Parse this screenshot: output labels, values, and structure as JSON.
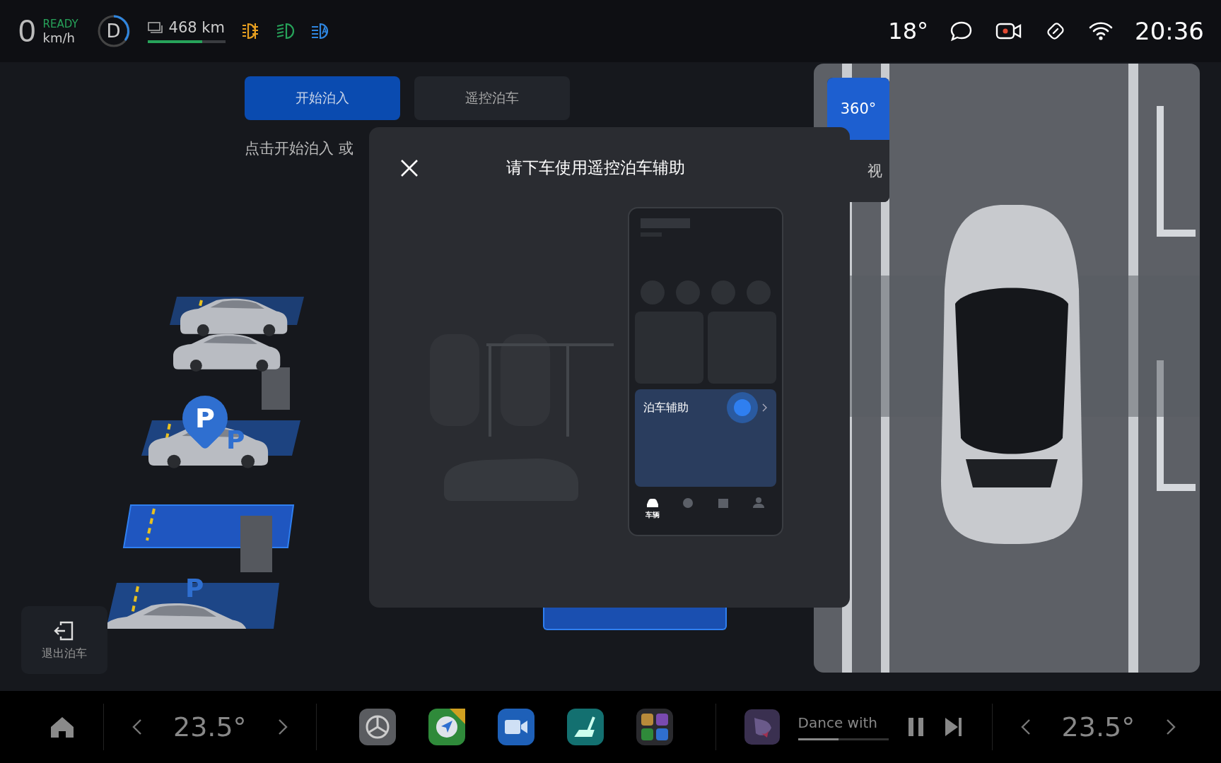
{
  "status_bar": {
    "speed": "0",
    "ready": "READY",
    "speed_unit": "km/h",
    "gear": "D",
    "range": "468 km",
    "range_bar": {
      "level": 0.7
    },
    "temperature": "18°",
    "time": "20:36"
  },
  "parking": {
    "tabs": [
      {
        "label": "开始泊入",
        "selected": true
      },
      {
        "label": "遥控泊车",
        "selected": false
      }
    ],
    "hint": "点击开始泊入 或",
    "slot_labels": [
      "P",
      "P"
    ],
    "pin_label": "P",
    "exit_label": "退出泊车"
  },
  "camera": {
    "views": [
      {
        "label": "360°",
        "selected": true
      },
      {
        "label": "视",
        "selected": false
      }
    ]
  },
  "dialog": {
    "title": "请下车使用遥控泊车辅助",
    "phone": {
      "card_title": "泊车辅助",
      "nav": [
        {
          "kind": "car",
          "label": "车辆",
          "selected": true
        },
        {
          "kind": "clock",
          "selected": false
        },
        {
          "kind": "bag",
          "selected": false
        },
        {
          "kind": "person",
          "selected": false
        }
      ]
    }
  },
  "dock": {
    "left_temp": "23.5°",
    "apps": [
      {
        "kind": "settings"
      },
      {
        "kind": "navigation"
      },
      {
        "kind": "video"
      },
      {
        "kind": "seat"
      },
      {
        "kind": "grid"
      }
    ],
    "media": {
      "title": "Dance with",
      "level": 0.45
    },
    "right_temp": "23.5°"
  }
}
